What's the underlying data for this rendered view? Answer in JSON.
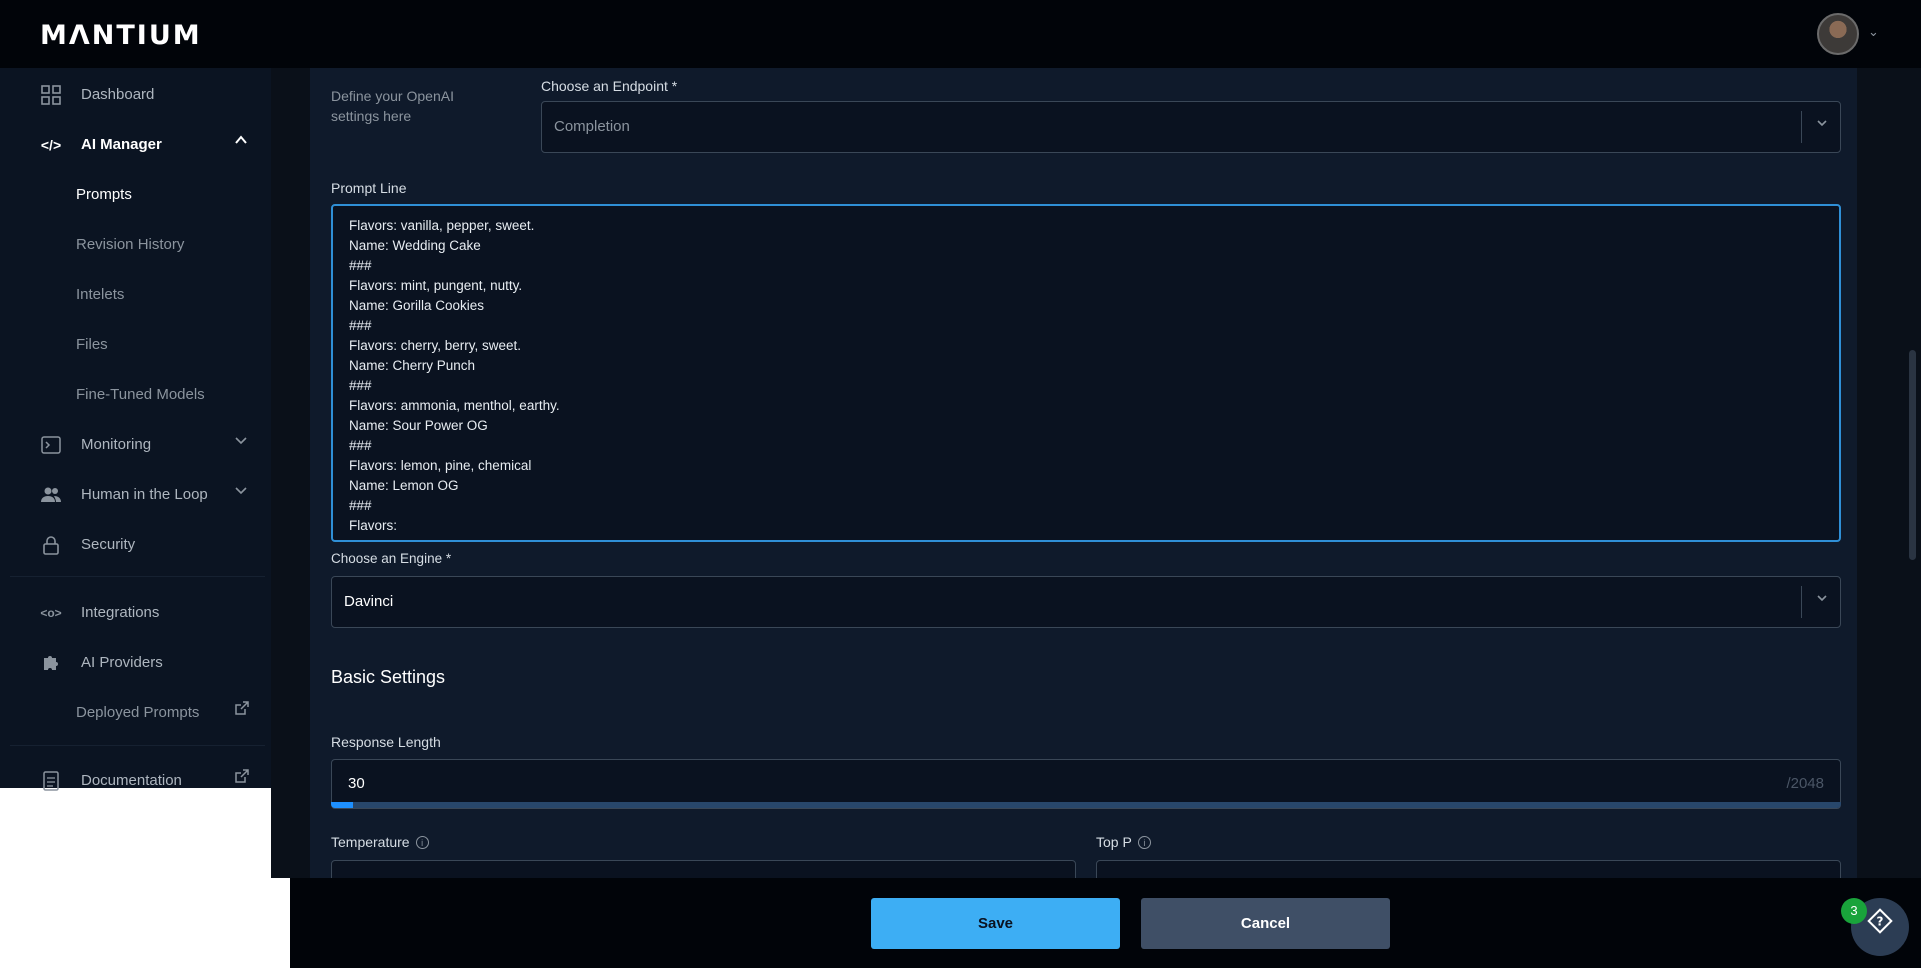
{
  "header": {
    "logo_text": "MΛNTIUM",
    "user_menu_chevron": "⌄"
  },
  "sidebar": {
    "items": [
      {
        "label": "Dashboard",
        "icon": "grid-icon"
      },
      {
        "label": "AI Manager",
        "icon": "code-icon",
        "expanded": true
      },
      {
        "label": "Prompts"
      },
      {
        "label": "Revision History"
      },
      {
        "label": "Intelets"
      },
      {
        "label": "Files"
      },
      {
        "label": "Fine-Tuned Models"
      },
      {
        "label": "Monitoring",
        "icon": "terminal-icon"
      },
      {
        "label": "Human in the Loop",
        "icon": "people-icon"
      },
      {
        "label": "Security",
        "icon": "lock-icon"
      },
      {
        "label": "Integrations",
        "icon": "integrations-icon"
      },
      {
        "label": "AI Providers",
        "icon": "puzzle-icon"
      },
      {
        "label": "Deployed Prompts",
        "icon": "external-link-icon"
      },
      {
        "label": "Documentation",
        "icon": "document-icon"
      }
    ]
  },
  "form": {
    "settings_hint": "Define your OpenAI settings here",
    "endpoint_label": "Choose an Endpoint *",
    "endpoint_value": "Completion",
    "prompt_label": "Prompt Line",
    "prompt_lines": [
      "Flavors: vanilla, pepper, sweet.",
      "Name: Wedding Cake",
      "###",
      "Flavors: mint, pungent, nutty.",
      "Name: Gorilla Cookies",
      "###",
      "Flavors: cherry, berry, sweet.",
      "Name: Cherry Punch",
      "###",
      "Flavors: ammonia, menthol, earthy.",
      "Name: Sour Power OG",
      "###",
      "Flavors: lemon, pine, chemical",
      "Name: Lemon OG",
      "###",
      "Flavors:"
    ],
    "engine_label": "Choose an Engine *",
    "engine_value": "Davinci",
    "basic_settings_title": "Basic Settings",
    "response_length_label": "Response Length",
    "response_length_value": "30",
    "response_length_max": "/2048",
    "response_length_fraction": 0.0146,
    "temperature_label": "Temperature",
    "top_p_label": "Top P"
  },
  "footer": {
    "save_label": "Save",
    "cancel_label": "Cancel"
  },
  "help": {
    "badge_count": "3",
    "icon": "help-icon"
  },
  "colors": {
    "accent": "#3daef4",
    "focus_border": "#2f8fd6",
    "badge_green": "#19a33b"
  }
}
